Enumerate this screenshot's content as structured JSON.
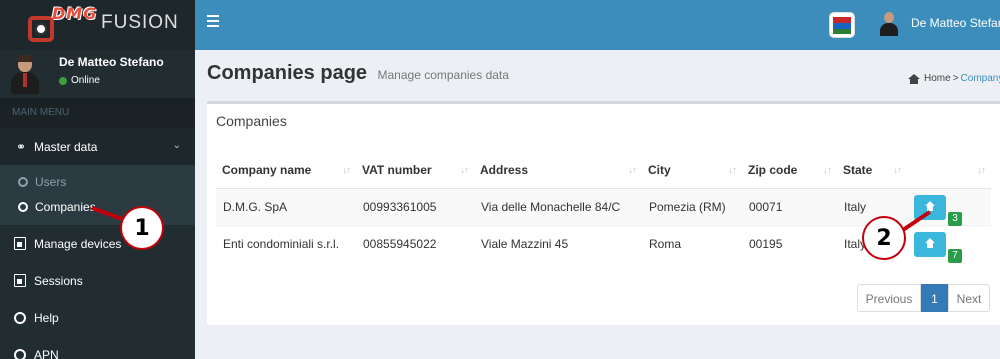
{
  "brand": {
    "mark": "DMG",
    "name": "FUSION"
  },
  "user": {
    "name": "De Matteo Stefano",
    "status": "Online"
  },
  "sidebar": {
    "header": "MAIN MENU",
    "master_data": {
      "label": "Master data",
      "icon": "share-icon",
      "children": [
        "Users",
        "Companies"
      ]
    },
    "items": [
      {
        "label": "Manage devices",
        "icon": "device-icon"
      },
      {
        "label": "Sessions",
        "icon": "sessions-icon"
      },
      {
        "label": "Help",
        "icon": "circle-icon"
      },
      {
        "label": "APN",
        "icon": "circle-icon"
      }
    ]
  },
  "header": {
    "user_name": "De Matteo Stefano"
  },
  "page": {
    "title": "Companies page",
    "subtitle": "Manage companies data",
    "breadcrumb": {
      "home": "Home",
      "separator": ">",
      "current": "Company"
    }
  },
  "box": {
    "title": "Companies"
  },
  "table": {
    "columns": [
      "Company name",
      "VAT number",
      "Address",
      "City",
      "Zip code",
      "State",
      ""
    ],
    "rows": [
      {
        "company": "D.M.G. SpA",
        "vat": "00993361005",
        "address": "Via delle Monachelle 84/C",
        "city": "Pomezia (RM)",
        "zip": "00071",
        "state": "Italy",
        "count": "3"
      },
      {
        "company": "Enti condominiali s.r.l.",
        "vat": "00855945022",
        "address": "Viale Mazzini 45",
        "city": "Roma",
        "zip": "00195",
        "state": "Italy",
        "count": "7"
      }
    ]
  },
  "pagination": {
    "previous": "Previous",
    "current": "1",
    "next": "Next"
  },
  "callouts": [
    "1",
    "2"
  ],
  "colors": {
    "sidebar": "#222d32",
    "header": "#3c8dbc",
    "button": "#3bb6dd",
    "badge": "#2a9d4a",
    "callout": "#c0000a"
  }
}
